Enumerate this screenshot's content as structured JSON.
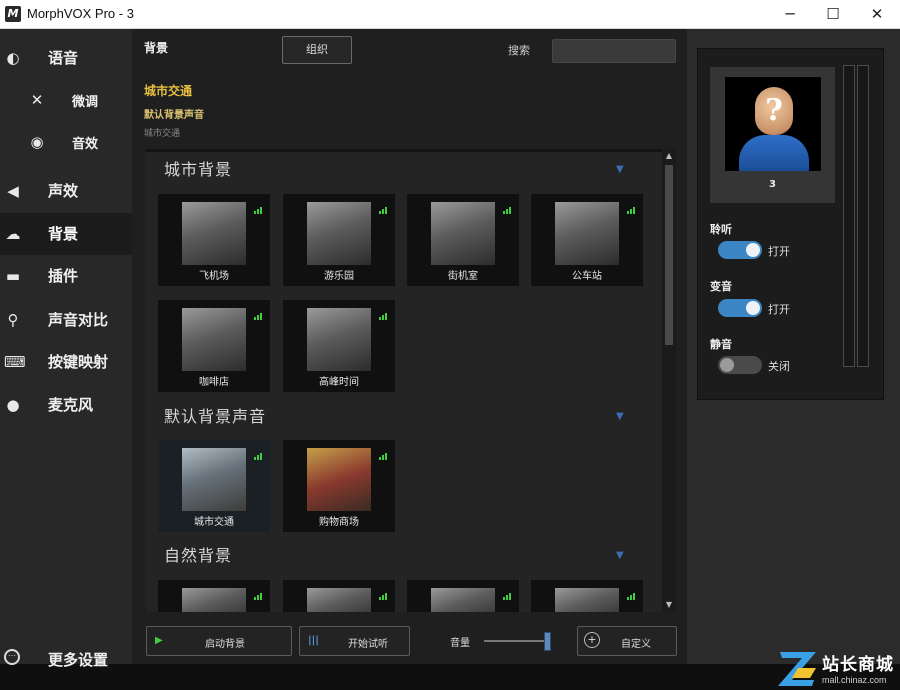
{
  "window": {
    "title": "MorphVOX Pro - 3",
    "app_icon_letter": "M",
    "min_glyph": "─",
    "max_glyph": "☐",
    "close_glyph": "✕"
  },
  "sidebar": {
    "items": [
      {
        "label": "语音",
        "icon": "voice-icon",
        "glyph": "◐"
      },
      {
        "label": "微调",
        "icon": "tools-icon",
        "glyph": "✕"
      },
      {
        "label": "音效",
        "icon": "lips-icon",
        "glyph": "◉"
      },
      {
        "label": "声效",
        "icon": "speaker-icon",
        "glyph": "◀"
      },
      {
        "label": "背景",
        "icon": "cloud-icon",
        "glyph": "☁"
      },
      {
        "label": "插件",
        "icon": "plug-icon",
        "glyph": "▬"
      },
      {
        "label": "声音对比",
        "icon": "magnifier-icon",
        "glyph": "⚲"
      },
      {
        "label": "按键映射",
        "icon": "keyboard-icon",
        "glyph": "⌨"
      },
      {
        "label": "麦克风",
        "icon": "mic-icon",
        "glyph": "●"
      }
    ],
    "more_label": "更多设置",
    "more_glyph": "⋯"
  },
  "header": {
    "title": "背景",
    "organize_label": "组织",
    "search_label": "搜索",
    "search_value": ""
  },
  "selection": {
    "name": "城市交通",
    "category": "默认背景声音",
    "description": "城市交通"
  },
  "sections": [
    {
      "title": "城市背景",
      "tiles": [
        "飞机场",
        "游乐园",
        "街机室",
        "公车站",
        "咖啡店",
        "高峰时间"
      ]
    },
    {
      "title": "默认背景声音",
      "tiles": [
        "城市交通",
        "购物商场"
      ]
    },
    {
      "title": "自然背景",
      "tiles": [
        "",
        "",
        "",
        ""
      ]
    }
  ],
  "list_chevron": "▼",
  "scroll_up": "▲",
  "scroll_down": "▼",
  "bottom_bar": {
    "start_bg_label": "启动背景",
    "start_bg_glyph": "▶",
    "listen_label": "开始试听",
    "listen_glyph": "|||",
    "volume_label": "音量",
    "volume_level": 0.95,
    "custom_label": "自定义",
    "custom_glyph": "+"
  },
  "right_panel": {
    "avatar_label": "3",
    "avatar_glyph": "?",
    "toggles": [
      {
        "label": "聆听",
        "state": "打开",
        "on": true
      },
      {
        "label": "变音",
        "state": "打开",
        "on": true
      },
      {
        "label": "静音",
        "state": "关闭",
        "on": false
      }
    ]
  },
  "watermark": {
    "title": "站长商城",
    "subtitle": "mall.chinaz.com"
  },
  "colors": {
    "accent_yellow": "#e8c040",
    "toggle_on": "#3d86c6",
    "signal_green": "#3fcf3f",
    "chevron_blue": "#3a6fb5"
  }
}
